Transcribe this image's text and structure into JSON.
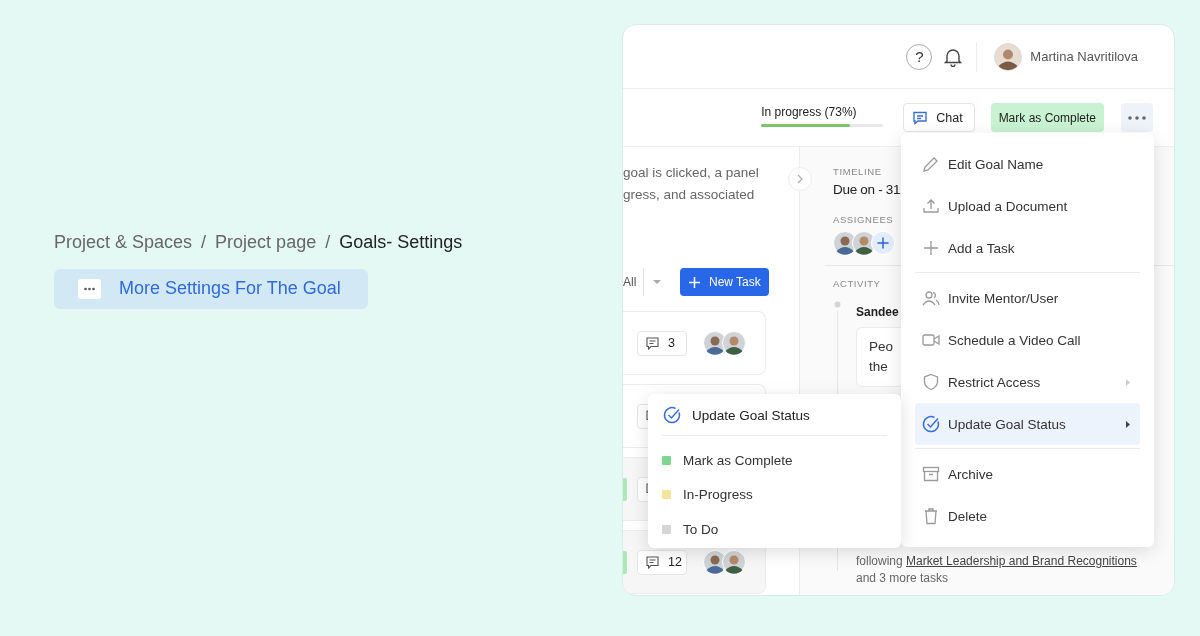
{
  "breadcrumb": [
    {
      "label": "Project & Spaces",
      "current": false,
      "separator": "/"
    },
    {
      "label": "Project page",
      "current": false,
      "separator": "/"
    },
    {
      "label": "Goals- Settings",
      "current": true
    }
  ],
  "feature_button": {
    "label": "More Settings For The Goal"
  },
  "app": {
    "header": {
      "help_label": "?",
      "user_name": "Martina Navritilova"
    },
    "toolbar": {
      "progress": {
        "label": "In progress (73%)",
        "level": 0.73
      },
      "chat_button": "Chat",
      "complete_button": "Mark as Complete"
    },
    "description_lines": [
      "goal is clicked, a panel",
      "gress, and associated"
    ],
    "filter": {
      "value": "All"
    },
    "new_task_button": "New Task",
    "tasks": [
      {
        "comments": "3",
        "accent": false
      },
      {
        "accent": false
      },
      {
        "accent": true
      },
      {
        "comments": "12",
        "accent": true
      }
    ],
    "details": {
      "timeline_label": "TIMELINE",
      "due": "Due on - 31",
      "assignees_label": "ASSIGNEES",
      "activity_label": "ACTIVITY",
      "activity_author": "Sandee",
      "comment_lines": [
        "Peo",
        "the"
      ],
      "assignment": {
        "prefix": "following",
        "link": "Market Leadership and Brand Recognitions",
        "suffix": "and 3 more tasks"
      }
    },
    "actions_menu": {
      "groups": [
        [
          {
            "label": "Edit Goal Name",
            "has_submenu": false,
            "selected": false
          },
          {
            "label": "Upload a Document",
            "has_submenu": false,
            "selected": false
          },
          {
            "label": "Add a Task",
            "has_submenu": false,
            "selected": false
          }
        ],
        [
          {
            "label": "Invite Mentor/User",
            "has_submenu": false,
            "selected": false
          },
          {
            "label": "Schedule a Video Call",
            "has_submenu": false,
            "selected": false
          },
          {
            "label": "Restrict Access",
            "has_submenu": true,
            "selected": false
          },
          {
            "label": "Update Goal Status",
            "has_submenu": true,
            "selected": true
          }
        ],
        [
          {
            "label": "Archive",
            "has_submenu": false,
            "selected": false
          },
          {
            "label": "Delete",
            "has_submenu": false,
            "selected": false
          }
        ]
      ]
    },
    "status_menu": {
      "title": "Update Goal Status",
      "items": [
        {
          "label": "Mark as Complete",
          "color": "#7fd68f"
        },
        {
          "label": "In-Progress",
          "color": "#f5e59a"
        },
        {
          "label": "To Do",
          "color": "#d6d6d6"
        }
      ]
    }
  }
}
